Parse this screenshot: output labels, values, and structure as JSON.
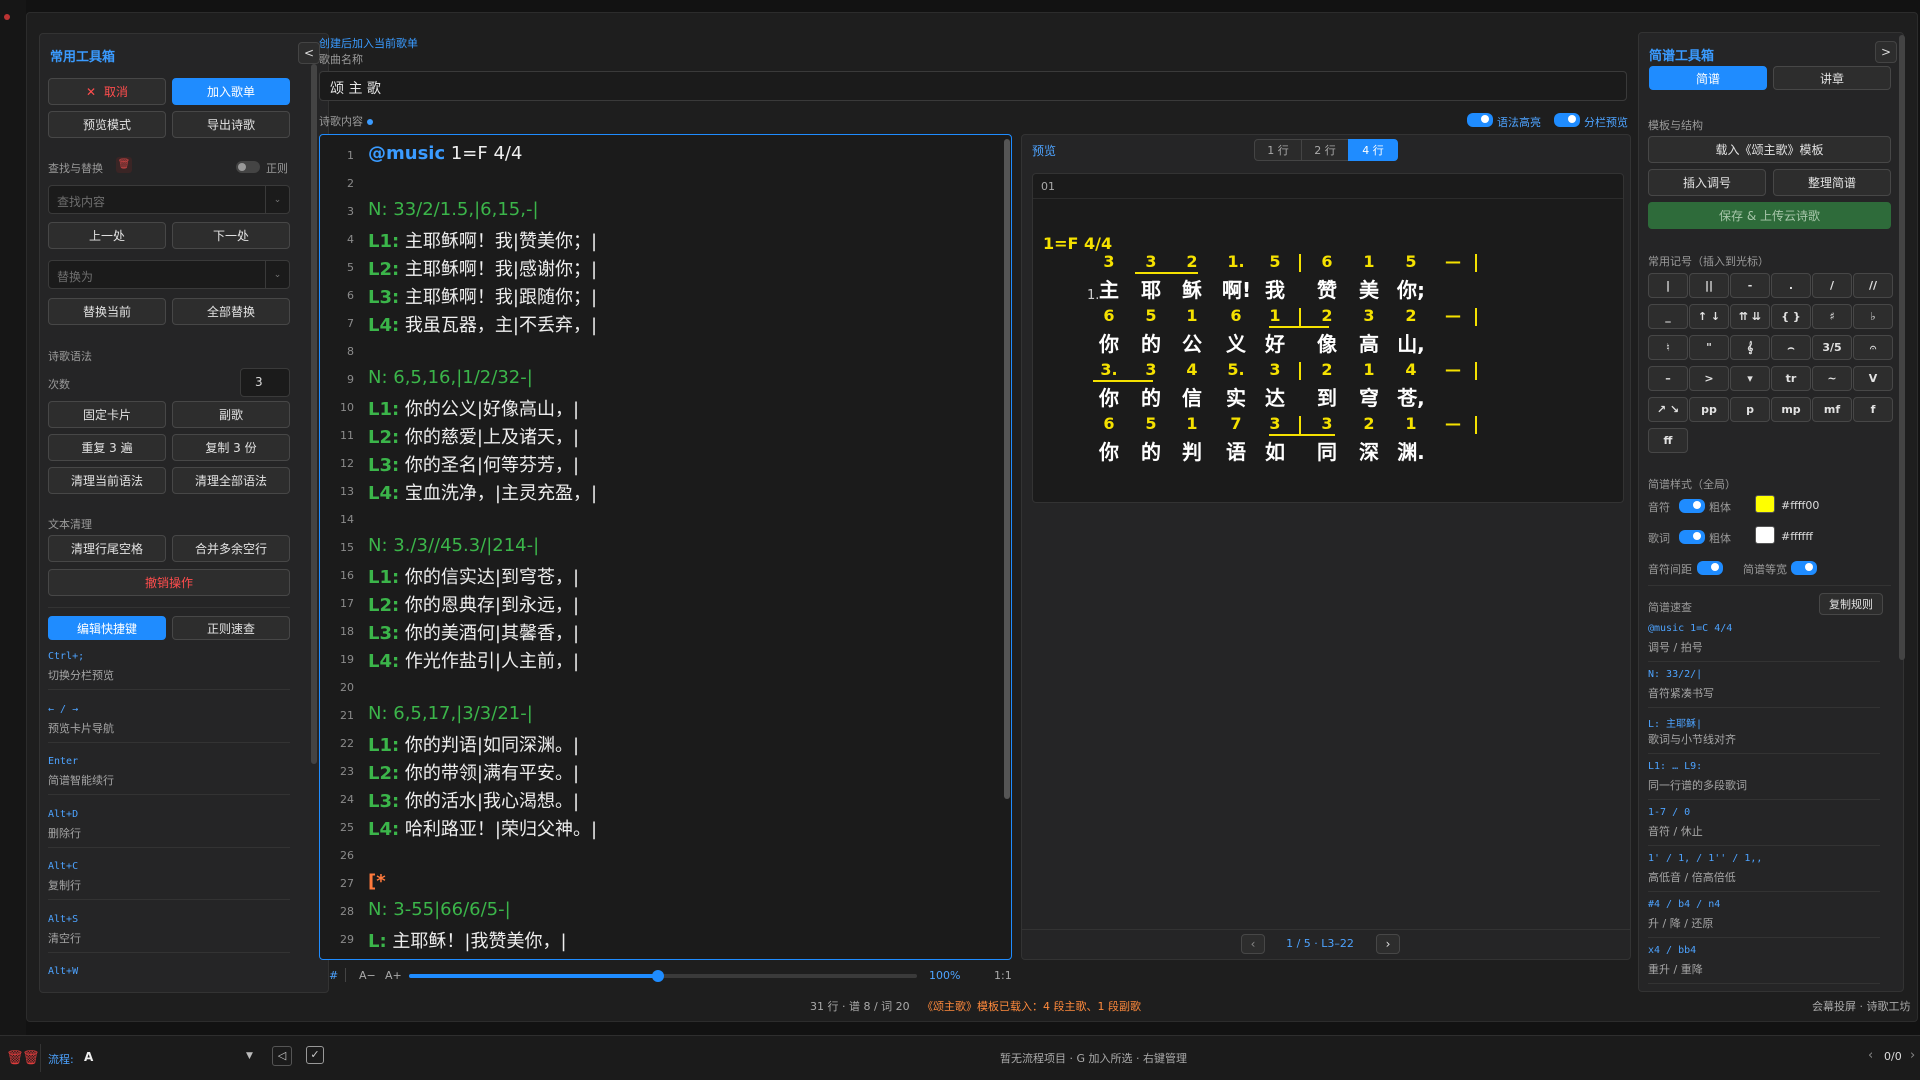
{
  "left_panel": {
    "title": "常用工具箱",
    "cancel": "取消",
    "add_playlist": "加入歌单",
    "preview_mode": "预览模式",
    "export_poem": "导出诗歌",
    "find_replace_label": "查找与替换",
    "regex_label": "正则",
    "find_placeholder": "查找内容",
    "prev": "上一处",
    "next": "下一处",
    "replace_placeholder": "替换为",
    "replace_current": "替换当前",
    "replace_all": "全部替换",
    "syntax_label": "诗歌语法",
    "count_label": "次数",
    "count_value": "3",
    "fixed_card": "固定卡片",
    "chorus": "副歌",
    "repeat3": "重复 3 遍",
    "copy3": "复制 3 份",
    "clear_current_syntax": "清理当前语法",
    "clear_all_syntax": "清理全部语法",
    "text_clean_label": "文本清理",
    "trim_trailing": "清理行尾空格",
    "merge_blank": "合并多余空行",
    "undo": "撤销操作",
    "edit_shortcuts": "编辑快捷键",
    "regex_quick": "正则速查",
    "shortcuts": [
      {
        "key": "Ctrl+;",
        "desc": "切换分栏预览"
      },
      {
        "key": "← / →",
        "desc": "预览卡片导航"
      },
      {
        "key": "Enter",
        "desc": "简谱智能续行"
      },
      {
        "key": "Alt+D",
        "desc": "删除行"
      },
      {
        "key": "Alt+C",
        "desc": "复制行"
      },
      {
        "key": "Alt+S",
        "desc": "清空行"
      },
      {
        "key": "Alt+W",
        "desc": ""
      }
    ]
  },
  "middle": {
    "create_link": "创建后加入当前歌单",
    "song_name_label": "歌曲名称",
    "song_name": "颂 主 歌",
    "content_label": "诗歌内容",
    "toggle_syntax": "语法高亮",
    "toggle_split": "分栏预览",
    "lines": [
      {
        "n": "1",
        "t": "@music 1=F 4/4"
      },
      {
        "n": "2",
        "t": ""
      },
      {
        "n": "3",
        "t": "N: 33/2/1.5,|6,15,-|"
      },
      {
        "n": "4",
        "t": "L1: 主耶稣啊！我|赞美你；|"
      },
      {
        "n": "5",
        "t": "L2: 主耶稣啊！我|感谢你；|"
      },
      {
        "n": "6",
        "t": "L3: 主耶稣啊！我|跟随你；|"
      },
      {
        "n": "7",
        "t": "L4: 我虽瓦器，主|不丢弃，|"
      },
      {
        "n": "8",
        "t": ""
      },
      {
        "n": "9",
        "t": "N: 6,5,16,|1/2/32-|"
      },
      {
        "n": "10",
        "t": "L1: 你的公义|好像高山，|"
      },
      {
        "n": "11",
        "t": "L2: 你的慈爱|上及诸天，|"
      },
      {
        "n": "12",
        "t": "L3: 你的圣名|何等芬芳，|"
      },
      {
        "n": "13",
        "t": "L4: 宝血洗净，|主灵充盈，|"
      },
      {
        "n": "14",
        "t": ""
      },
      {
        "n": "15",
        "t": "N: 3./3//45.3/|214-|"
      },
      {
        "n": "16",
        "t": "L1: 你的信实达|到穹苍，|"
      },
      {
        "n": "17",
        "t": "L2: 你的恩典存|到永远，|"
      },
      {
        "n": "18",
        "t": "L3: 你的美酒何|其馨香，|"
      },
      {
        "n": "19",
        "t": "L4: 作光作盐引|人主前，|"
      },
      {
        "n": "20",
        "t": ""
      },
      {
        "n": "21",
        "t": "N: 6,5,17,|3/3/21-|"
      },
      {
        "n": "22",
        "t": "L1: 你的判语|如同深渊。|"
      },
      {
        "n": "23",
        "t": "L2: 你的带领|满有平安。|"
      },
      {
        "n": "24",
        "t": "L3: 你的活水|我心渴想。|"
      },
      {
        "n": "25",
        "t": "L4: 哈利路亚！|荣归父神。|"
      },
      {
        "n": "26",
        "t": ""
      },
      {
        "n": "27",
        "t": "[*"
      },
      {
        "n": "28",
        "t": "N: 3-55|66/6/5-|"
      },
      {
        "n": "29",
        "t": "L: 主耶稣！|我赞美你，|"
      }
    ],
    "editor_footer": {
      "hash": "#",
      "a_minus": "A−",
      "a_plus": "A+",
      "zoom": "100%",
      "ratio": "1:1",
      "zoom_fraction": 0.49
    }
  },
  "preview": {
    "title": "预览",
    "tabs": [
      "1 行",
      "2 行",
      "4 行"
    ],
    "card_id": "01",
    "key_sig": "1=F 4/4",
    "verse_no": "1.",
    "rows": [
      {
        "notes": [
          "3",
          "3",
          "2",
          "1.",
          "5",
          "6",
          "1",
          "5",
          "—"
        ],
        "lyrics": [
          "主",
          "耶",
          "稣",
          "啊!",
          "我",
          "赞",
          "美",
          "你;"
        ]
      },
      {
        "notes": [
          "6",
          "5",
          "1",
          "6",
          "1",
          "2",
          "3",
          "2",
          "—"
        ],
        "lyrics": [
          "你",
          "的",
          "公",
          "义",
          "好",
          "像",
          "高",
          "山,"
        ]
      },
      {
        "notes": [
          "3.",
          "3",
          "4",
          "5.",
          "3",
          "2",
          "1",
          "4",
          "—"
        ],
        "lyrics": [
          "你",
          "的",
          "信",
          "实",
          "达",
          "到",
          "穹",
          "苍,"
        ]
      },
      {
        "notes": [
          "6",
          "5",
          "1",
          "7",
          "3",
          "3",
          "2",
          "1",
          "—"
        ],
        "lyrics": [
          "你",
          "的",
          "判",
          "语",
          "如",
          "同",
          "深",
          "渊."
        ]
      }
    ],
    "pager": "1 / 5 · L3–22",
    "prev": "‹",
    "next": "›"
  },
  "right_panel": {
    "title": "简谱工具箱",
    "tab_jianpu": "简谱",
    "tab_lecture": "讲章",
    "template_label": "模板与结构",
    "load_template": "载入《颂主歌》模板",
    "insert_key": "插入调号",
    "tidy": "整理简谱",
    "save_cloud": "保存 & 上传云诗歌",
    "symbols_label": "常用记号（插入到光标）",
    "symbols": [
      "|",
      "||",
      "-",
      ".",
      "/",
      "//",
      "_",
      "↑ ↓",
      "⇈ ⇊",
      "{ }",
      "♯",
      "♭",
      "♮",
      "\"",
      "𝄞",
      "⌢",
      "3/5",
      "𝄐",
      "–",
      ">",
      "▾",
      "tr",
      "~",
      "V",
      "↗ ↘",
      "pp",
      "p",
      "mp",
      "mf",
      "f",
      "ff"
    ],
    "style_label": "简谱样式（全局）",
    "note_label": "音符",
    "bold_label": "粗体",
    "note_color": "#ffff00",
    "note_color_text": "#ffff00",
    "lyric_label": "歌词",
    "lyric_color": "#ffffff",
    "lyric_color_text": "#ffffff",
    "spacing_label": "音符间距",
    "equal_width_label": "简谱等宽",
    "quickref_label": "简谱速查",
    "copy_rules": "复制规则",
    "refs": [
      {
        "key": "@music 1=C 4/4",
        "desc": "调号 / 拍号"
      },
      {
        "key": "N: 33/2/|",
        "desc": "音符紧凑书写"
      },
      {
        "key": "L: 主耶稣|",
        "desc": "歌词与小节线对齐"
      },
      {
        "key": "L1: … L9:",
        "desc": "同一行谱的多段歌词"
      },
      {
        "key": "1-7 / 0",
        "desc": "音符 / 休止"
      },
      {
        "key": "1' / 1, / 1'' / 1,,",
        "desc": "高低音 / 倍高倍低"
      },
      {
        "key": "#4 / b4 / n4",
        "desc": "升 / 降 / 还原"
      },
      {
        "key": "x4 / bb4",
        "desc": "重升 / 重降"
      }
    ]
  },
  "status": {
    "stats": "31 行 · 谱 8 / 词 20",
    "message": "《颂主歌》模板已载入：4 段主歌、1 段副歌",
    "right": "会幕投屏 · 诗歌工坊"
  },
  "bottom": {
    "flow_label": "流程:",
    "flow_value": "A",
    "center": "暂无流程项目 · G 加入所选 · 右键管理",
    "counter": "0/0"
  }
}
